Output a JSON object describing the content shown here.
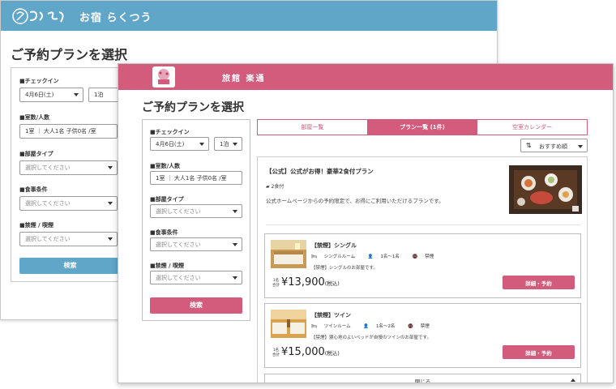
{
  "colors": {
    "back_accent": "#5fa6c8",
    "front_accent": "#d35b7b"
  },
  "back": {
    "brand": "お宿 らくつう",
    "title": "ご予約プランを選択",
    "checkin_label": "■チェックイン",
    "checkin_date": "4月6日(土)",
    "nights": "1泊",
    "rooms_label": "■室数/人数",
    "rooms_value": "1室 ｜ 大人1名 子供0名 /室",
    "roomtype_label": "■部屋タイプ",
    "roomtype_placeholder": "選択してください",
    "meal_label": "■食事条件",
    "meal_placeholder": "選択してください",
    "smoking_label": "■禁煙 / 喫煙",
    "smoking_placeholder": "選択してください",
    "search_button": "検索"
  },
  "front": {
    "brand": "旅館 楽通",
    "title": "ご予約プランを選択",
    "checkin_label": "■チェックイン",
    "checkin_date": "4月6日(土)",
    "nights": "1泊",
    "rooms_label": "■室数/人数",
    "rooms_value": "1室 ｜ 大人1名 子供0名 /室",
    "roomtype_label": "■部屋タイプ",
    "roomtype_placeholder": "選択してください",
    "meal_label": "■食事条件",
    "meal_placeholder": "選択してください",
    "smoking_label": "■禁煙 / 喫煙",
    "smoking_placeholder": "選択してください",
    "search_button": "検索",
    "tabs": [
      "部屋一覧",
      "プラン一覧 (1件)",
      "空室カレンダー"
    ],
    "sort_value": "おすすめ順",
    "plan": {
      "title": "【公式】公式がお得！豪華2食付プラン",
      "meal": "2食付",
      "description": "公式ホームページからの予約限定で、お得にご利用いただけるプランです。",
      "rooms": [
        {
          "name": "【禁煙】シングル",
          "room_type": "シングルルーム",
          "capacity": "1名～1名",
          "smoking": "禁煙",
          "description": "【禁煙】シングルのお部屋です。",
          "per_person": "1名合計",
          "price": "¥13,900",
          "tax": "(税込)",
          "button": "詳細・予約"
        },
        {
          "name": "【禁煙】ツイン",
          "room_type": "ツインルーム",
          "capacity": "1名～2名",
          "smoking": "禁煙",
          "description": "【禁煙】寝心地のよいベッドが自慢のツインのお部屋です。",
          "per_person": "1名合計",
          "price": "¥15,000",
          "tax": "(税込)",
          "button": "詳細・予約"
        }
      ],
      "close_label": "閉じる"
    }
  }
}
